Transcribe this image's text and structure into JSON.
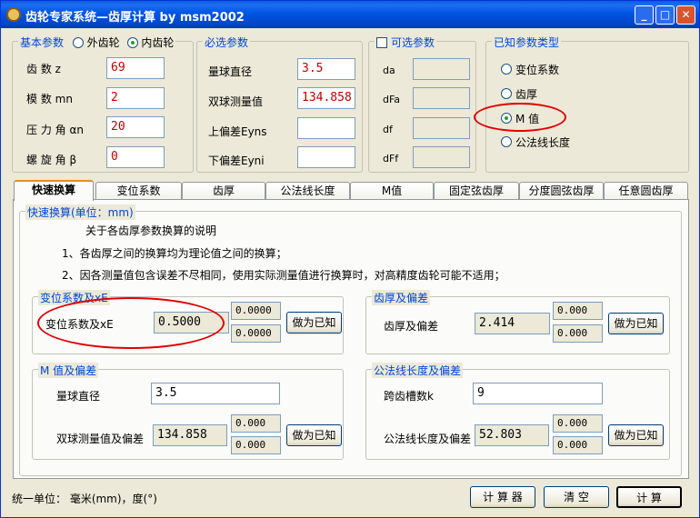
{
  "window": {
    "title": "齿轮专家系统—齿厚计算 by msm2002"
  },
  "basic": {
    "title": "基本参数",
    "radio_outer": "外齿轮",
    "radio_inner": "内齿轮",
    "selected": "inner",
    "rows": [
      {
        "label": "齿      数 z",
        "value": "69"
      },
      {
        "label": "模    数 mn",
        "value": "2"
      },
      {
        "label": "压 力 角 αn",
        "value": "20"
      },
      {
        "label": "螺 旋 角 β",
        "value": "0"
      }
    ]
  },
  "required": {
    "title": "必选参数",
    "rows": [
      {
        "label": "量球直径",
        "value": "3.5"
      },
      {
        "label": "双球测量值",
        "value": "134.858"
      },
      {
        "label": "上偏差Eyns",
        "value": ""
      },
      {
        "label": "下偏差Eyni",
        "value": ""
      }
    ]
  },
  "optional": {
    "title": "可选参数",
    "checked": false,
    "rows": [
      {
        "label": "da",
        "value": ""
      },
      {
        "label": "dFa",
        "value": ""
      },
      {
        "label": "df",
        "value": ""
      },
      {
        "label": "dFf",
        "value": ""
      }
    ]
  },
  "known": {
    "title": "已知参数类型",
    "options": [
      "变位系数",
      "齿厚",
      "M 值",
      "公法线长度"
    ],
    "selected_index": 2
  },
  "tabs": [
    "快速换算",
    "变位系数",
    "齿厚",
    "公法线长度",
    "M值",
    "固定弦齿厚",
    "分度圆弦齿厚",
    "任意圆齿厚"
  ],
  "active_tab": 0,
  "quick": {
    "title": "快速换算(单位：mm)",
    "notes": [
      "关于各齿厚参数换算的说明",
      "1、各齿厚之间的换算均为理论值之间的换算；",
      "2、因各测量值包含误差不尽相同，使用实际测量值进行换算时，对高精度齿轮可能不适用；"
    ],
    "shift": {
      "title": "变位系数及xE",
      "label": "变位系数及xE",
      "value": "0.5000",
      "dev_upper": "0.0000",
      "dev_lower": "0.0000",
      "button": "做为已知"
    },
    "thickness": {
      "title": "齿厚及偏差",
      "label": "齿厚及偏差",
      "value": "2.414",
      "dev_upper": "0.000",
      "dev_lower": "0.000",
      "button": "做为已知"
    },
    "mvalue": {
      "title": "M 值及偏差",
      "ball_label": "量球直径",
      "ball_value": "3.5",
      "label": "双球测量值及偏差",
      "value": "134.858",
      "dev_upper": "0.000",
      "dev_lower": "0.000",
      "button": "做为已知"
    },
    "wk": {
      "title": "公法线长度及偏差",
      "k_label": "跨齿槽数k",
      "k_value": "9",
      "label": "公法线长度及偏差",
      "value": "52.803",
      "dev_upper": "0.000",
      "dev_lower": "0.000",
      "button": "做为已知"
    }
  },
  "footer": {
    "units": "统一单位： 毫米(mm)，度(°)",
    "calc_tool": "计 算 器",
    "clear": "清   空",
    "compute": "计   算"
  }
}
